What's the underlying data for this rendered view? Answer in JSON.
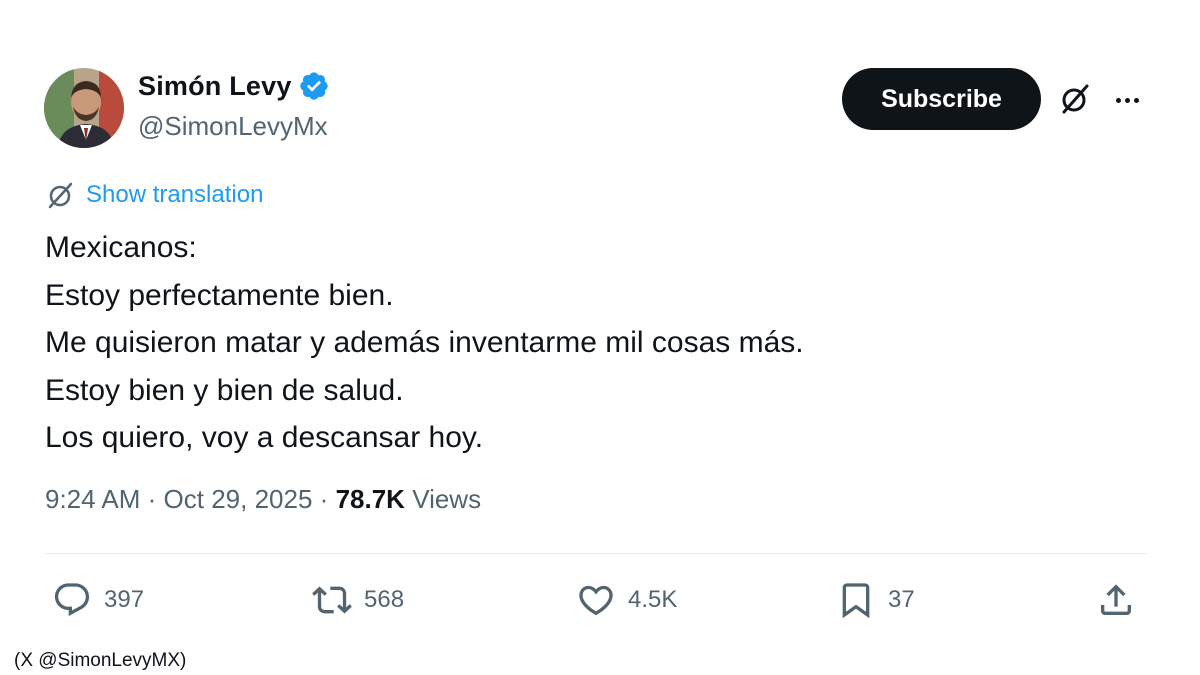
{
  "author": {
    "name": "Simón Levy",
    "handle": "@SimonLevyMx",
    "verified": true,
    "verified_color": "#1d9bf0"
  },
  "header_actions": {
    "subscribe_label": "Subscribe",
    "grok_icon": "grok-icon",
    "more_icon": "more-icon"
  },
  "translation": {
    "label": "Show translation",
    "icon": "translate-icon",
    "color": "#1d9bf0"
  },
  "tweet": {
    "lines": [
      "Mexicanos:",
      "Estoy perfectamente bien.",
      "Me quisieron matar y además inventarme mil cosas más.",
      "Estoy bien y bien de salud.",
      "Los quiero, voy a descansar hoy."
    ]
  },
  "meta": {
    "time": "9:24 AM",
    "separator": "·",
    "date": "Oct 29, 2025",
    "views_count": "78.7K",
    "views_label": "Views"
  },
  "actions": {
    "replies": "397",
    "reposts": "568",
    "likes": "4.5K",
    "bookmarks": "37"
  },
  "caption": "(X @SimonLevyMX)"
}
